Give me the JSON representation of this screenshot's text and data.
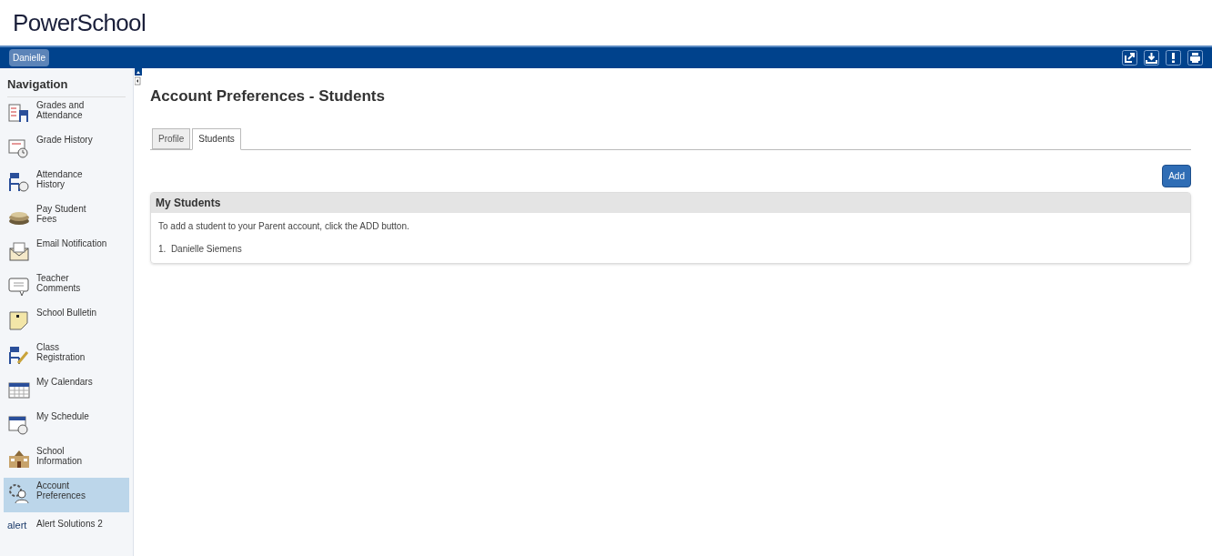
{
  "logo": "PowerSchool",
  "student_button": "Danielle",
  "sidebar": {
    "title": "Navigation",
    "items": [
      {
        "label": "Grades and Attendance",
        "selected": false
      },
      {
        "label": "Grade History",
        "selected": false
      },
      {
        "label": "Attendance History",
        "selected": false
      },
      {
        "label": "Pay Student Fees",
        "selected": false
      },
      {
        "label": "Email Notification",
        "selected": false
      },
      {
        "label": "Teacher Comments",
        "selected": false
      },
      {
        "label": "School Bulletin",
        "selected": false
      },
      {
        "label": "Class Registration",
        "selected": false
      },
      {
        "label": "My Calendars",
        "selected": false
      },
      {
        "label": "My Schedule",
        "selected": false
      },
      {
        "label": "School Information",
        "selected": false
      },
      {
        "label": "Account Preferences",
        "selected": true
      },
      {
        "label": "Alert Solutions 2",
        "selected": false,
        "logo_text": "alert"
      }
    ]
  },
  "page_title": "Account Preferences - Students",
  "tabs": [
    {
      "label": "Profile",
      "selected": false
    },
    {
      "label": "Students",
      "selected": true
    }
  ],
  "add_button": "Add",
  "panel": {
    "title": "My Students",
    "instruction": "To add a student to your Parent account, click the ADD button.",
    "students": [
      "1.  Danielle Siemens"
    ]
  }
}
